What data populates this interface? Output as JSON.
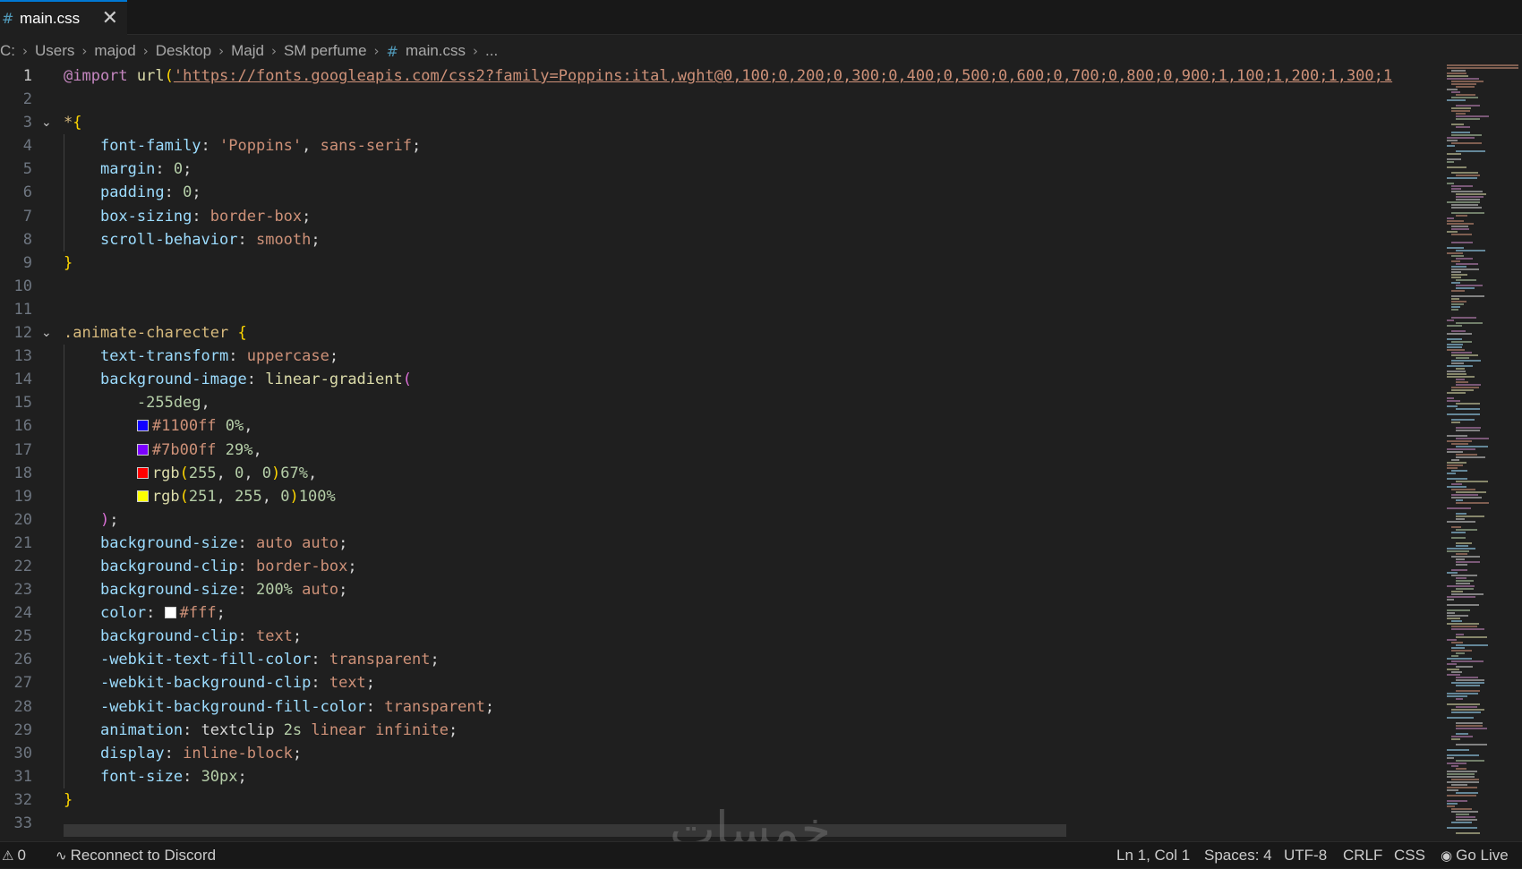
{
  "tab": {
    "label": "main.css",
    "icon": "css-hash-icon",
    "icon_glyph": "#",
    "close_glyph": "✕"
  },
  "breadcrumb": {
    "items": [
      "C:",
      "Users",
      "majod",
      "Desktop",
      "Majd",
      "SM perfume"
    ],
    "file_icon": "#",
    "file": "main.css",
    "more": "..."
  },
  "code_lines": [
    [
      {
        "c": "t-at",
        "t": "@import"
      },
      {
        "c": "t-punc",
        "t": " "
      },
      {
        "c": "t-fn",
        "t": "url"
      },
      {
        "c": "t-b1",
        "t": "("
      },
      {
        "c": "t-str t-uline",
        "t": "'https://fonts.googleapis.com/css2?family=Poppins:ital,wght@0,100;0,200;0,300;0,400;0,500;0,600;0,700;0,800;0,900;1,100;1,200;1,300;1"
      }
    ],
    [],
    [
      {
        "c": "t-sel",
        "t": "*"
      },
      {
        "c": "t-b1",
        "t": "{"
      }
    ],
    [
      {
        "c": "t-punc",
        "t": "    "
      },
      {
        "c": "t-prop",
        "t": "font-family"
      },
      {
        "c": "t-punc",
        "t": ": "
      },
      {
        "c": "t-str",
        "t": "'Poppins'"
      },
      {
        "c": "t-punc",
        "t": ", "
      },
      {
        "c": "t-val",
        "t": "sans-serif"
      },
      {
        "c": "t-punc",
        "t": ";"
      }
    ],
    [
      {
        "c": "t-punc",
        "t": "    "
      },
      {
        "c": "t-prop",
        "t": "margin"
      },
      {
        "c": "t-punc",
        "t": ": "
      },
      {
        "c": "t-num",
        "t": "0"
      },
      {
        "c": "t-punc",
        "t": ";"
      }
    ],
    [
      {
        "c": "t-punc",
        "t": "    "
      },
      {
        "c": "t-prop",
        "t": "padding"
      },
      {
        "c": "t-punc",
        "t": ": "
      },
      {
        "c": "t-num",
        "t": "0"
      },
      {
        "c": "t-punc",
        "t": ";"
      }
    ],
    [
      {
        "c": "t-punc",
        "t": "    "
      },
      {
        "c": "t-prop",
        "t": "box-sizing"
      },
      {
        "c": "t-punc",
        "t": ": "
      },
      {
        "c": "t-val",
        "t": "border-box"
      },
      {
        "c": "t-punc",
        "t": ";"
      }
    ],
    [
      {
        "c": "t-punc",
        "t": "    "
      },
      {
        "c": "t-prop",
        "t": "scroll-behavior"
      },
      {
        "c": "t-punc",
        "t": ": "
      },
      {
        "c": "t-val",
        "t": "smooth"
      },
      {
        "c": "t-punc",
        "t": ";"
      }
    ],
    [
      {
        "c": "t-b1",
        "t": "}"
      }
    ],
    [],
    [],
    [
      {
        "c": "t-sel",
        "t": ".animate-charecter"
      },
      {
        "c": "t-punc",
        "t": " "
      },
      {
        "c": "t-b1",
        "t": "{"
      }
    ],
    [
      {
        "c": "t-punc",
        "t": "    "
      },
      {
        "c": "t-prop",
        "t": "text-transform"
      },
      {
        "c": "t-punc",
        "t": ": "
      },
      {
        "c": "t-val",
        "t": "uppercase"
      },
      {
        "c": "t-punc",
        "t": ";"
      }
    ],
    [
      {
        "c": "t-punc",
        "t": "    "
      },
      {
        "c": "t-prop",
        "t": "background-image"
      },
      {
        "c": "t-punc",
        "t": ": "
      },
      {
        "c": "t-fn",
        "t": "linear-gradient"
      },
      {
        "c": "t-b2",
        "t": "("
      }
    ],
    [
      {
        "c": "t-punc",
        "t": "        "
      },
      {
        "c": "t-num",
        "t": "-255deg"
      },
      {
        "c": "t-punc",
        "t": ","
      }
    ],
    [
      {
        "c": "t-punc",
        "t": "        "
      },
      {
        "sw": "#1100ff"
      },
      {
        "c": "t-val",
        "t": "#1100ff"
      },
      {
        "c": "t-punc",
        "t": " "
      },
      {
        "c": "t-num",
        "t": "0%"
      },
      {
        "c": "t-punc",
        "t": ","
      }
    ],
    [
      {
        "c": "t-punc",
        "t": "        "
      },
      {
        "sw": "#7b00ff"
      },
      {
        "c": "t-val",
        "t": "#7b00ff"
      },
      {
        "c": "t-punc",
        "t": " "
      },
      {
        "c": "t-num",
        "t": "29%"
      },
      {
        "c": "t-punc",
        "t": ","
      }
    ],
    [
      {
        "c": "t-punc",
        "t": "        "
      },
      {
        "sw": "#ff0000"
      },
      {
        "c": "t-fn",
        "t": "rgb"
      },
      {
        "c": "t-b1",
        "t": "("
      },
      {
        "c": "t-num",
        "t": "255"
      },
      {
        "c": "t-punc",
        "t": ", "
      },
      {
        "c": "t-num",
        "t": "0"
      },
      {
        "c": "t-punc",
        "t": ", "
      },
      {
        "c": "t-num",
        "t": "0"
      },
      {
        "c": "t-b1",
        "t": ")"
      },
      {
        "c": "t-num",
        "t": "67%"
      },
      {
        "c": "t-punc",
        "t": ","
      }
    ],
    [
      {
        "c": "t-punc",
        "t": "        "
      },
      {
        "sw": "#fbff00"
      },
      {
        "c": "t-fn",
        "t": "rgb"
      },
      {
        "c": "t-b1",
        "t": "("
      },
      {
        "c": "t-num",
        "t": "251"
      },
      {
        "c": "t-punc",
        "t": ", "
      },
      {
        "c": "t-num",
        "t": "255"
      },
      {
        "c": "t-punc",
        "t": ", "
      },
      {
        "c": "t-num",
        "t": "0"
      },
      {
        "c": "t-b1",
        "t": ")"
      },
      {
        "c": "t-num",
        "t": "100%"
      }
    ],
    [
      {
        "c": "t-punc",
        "t": "    "
      },
      {
        "c": "t-b2",
        "t": ")"
      },
      {
        "c": "t-punc",
        "t": ";"
      }
    ],
    [
      {
        "c": "t-punc",
        "t": "    "
      },
      {
        "c": "t-prop",
        "t": "background-size"
      },
      {
        "c": "t-punc",
        "t": ": "
      },
      {
        "c": "t-val",
        "t": "auto auto"
      },
      {
        "c": "t-punc",
        "t": ";"
      }
    ],
    [
      {
        "c": "t-punc",
        "t": "    "
      },
      {
        "c": "t-prop",
        "t": "background-clip"
      },
      {
        "c": "t-punc",
        "t": ": "
      },
      {
        "c": "t-val",
        "t": "border-box"
      },
      {
        "c": "t-punc",
        "t": ";"
      }
    ],
    [
      {
        "c": "t-punc",
        "t": "    "
      },
      {
        "c": "t-prop",
        "t": "background-size"
      },
      {
        "c": "t-punc",
        "t": ": "
      },
      {
        "c": "t-num",
        "t": "200%"
      },
      {
        "c": "t-punc",
        "t": " "
      },
      {
        "c": "t-val",
        "t": "auto"
      },
      {
        "c": "t-punc",
        "t": ";"
      }
    ],
    [
      {
        "c": "t-punc",
        "t": "    "
      },
      {
        "c": "t-prop",
        "t": "color"
      },
      {
        "c": "t-punc",
        "t": ": "
      },
      {
        "sw": "#ffffff"
      },
      {
        "c": "t-val",
        "t": "#fff"
      },
      {
        "c": "t-punc",
        "t": ";"
      }
    ],
    [
      {
        "c": "t-punc",
        "t": "    "
      },
      {
        "c": "t-prop",
        "t": "background-clip"
      },
      {
        "c": "t-punc",
        "t": ": "
      },
      {
        "c": "t-val",
        "t": "text"
      },
      {
        "c": "t-punc",
        "t": ";"
      }
    ],
    [
      {
        "c": "t-punc",
        "t": "    "
      },
      {
        "c": "t-prop",
        "t": "-webkit-text-fill-color"
      },
      {
        "c": "t-punc",
        "t": ": "
      },
      {
        "c": "t-val",
        "t": "transparent"
      },
      {
        "c": "t-punc",
        "t": ";"
      }
    ],
    [
      {
        "c": "t-punc",
        "t": "    "
      },
      {
        "c": "t-prop",
        "t": "-webkit-background-clip"
      },
      {
        "c": "t-punc",
        "t": ": "
      },
      {
        "c": "t-val",
        "t": "text"
      },
      {
        "c": "t-punc",
        "t": ";"
      }
    ],
    [
      {
        "c": "t-punc",
        "t": "    "
      },
      {
        "c": "t-prop",
        "t": "-webkit-background-fill-color"
      },
      {
        "c": "t-punc",
        "t": ": "
      },
      {
        "c": "t-val",
        "t": "transparent"
      },
      {
        "c": "t-punc",
        "t": ";"
      }
    ],
    [
      {
        "c": "t-punc",
        "t": "    "
      },
      {
        "c": "t-prop",
        "t": "animation"
      },
      {
        "c": "t-punc",
        "t": ": "
      },
      {
        "c": "t-punc",
        "t": "textclip "
      },
      {
        "c": "t-num",
        "t": "2s"
      },
      {
        "c": "t-punc",
        "t": " "
      },
      {
        "c": "t-val",
        "t": "linear infinite"
      },
      {
        "c": "t-punc",
        "t": ";"
      }
    ],
    [
      {
        "c": "t-punc",
        "t": "    "
      },
      {
        "c": "t-prop",
        "t": "display"
      },
      {
        "c": "t-punc",
        "t": ": "
      },
      {
        "c": "t-val",
        "t": "inline-block"
      },
      {
        "c": "t-punc",
        "t": ";"
      }
    ],
    [
      {
        "c": "t-punc",
        "t": "    "
      },
      {
        "c": "t-prop",
        "t": "font-size"
      },
      {
        "c": "t-punc",
        "t": ": "
      },
      {
        "c": "t-num",
        "t": "30px"
      },
      {
        "c": "t-punc",
        "t": ";"
      }
    ],
    [
      {
        "c": "t-b1",
        "t": "}"
      }
    ],
    []
  ],
  "fold_lines": [
    3,
    12
  ],
  "active_line": 1,
  "status": {
    "warnings": "0",
    "discord": "Reconnect to Discord",
    "position": "Ln 1, Col 1",
    "spaces": "Spaces: 4",
    "encoding": "UTF-8",
    "eol": "CRLF",
    "language": "CSS",
    "golive": "Go Live"
  },
  "watermark": "خمسات",
  "colors": {
    "accent": "#0078d4",
    "editor_bg": "#1f1f1f",
    "chrome_bg": "#181818"
  }
}
